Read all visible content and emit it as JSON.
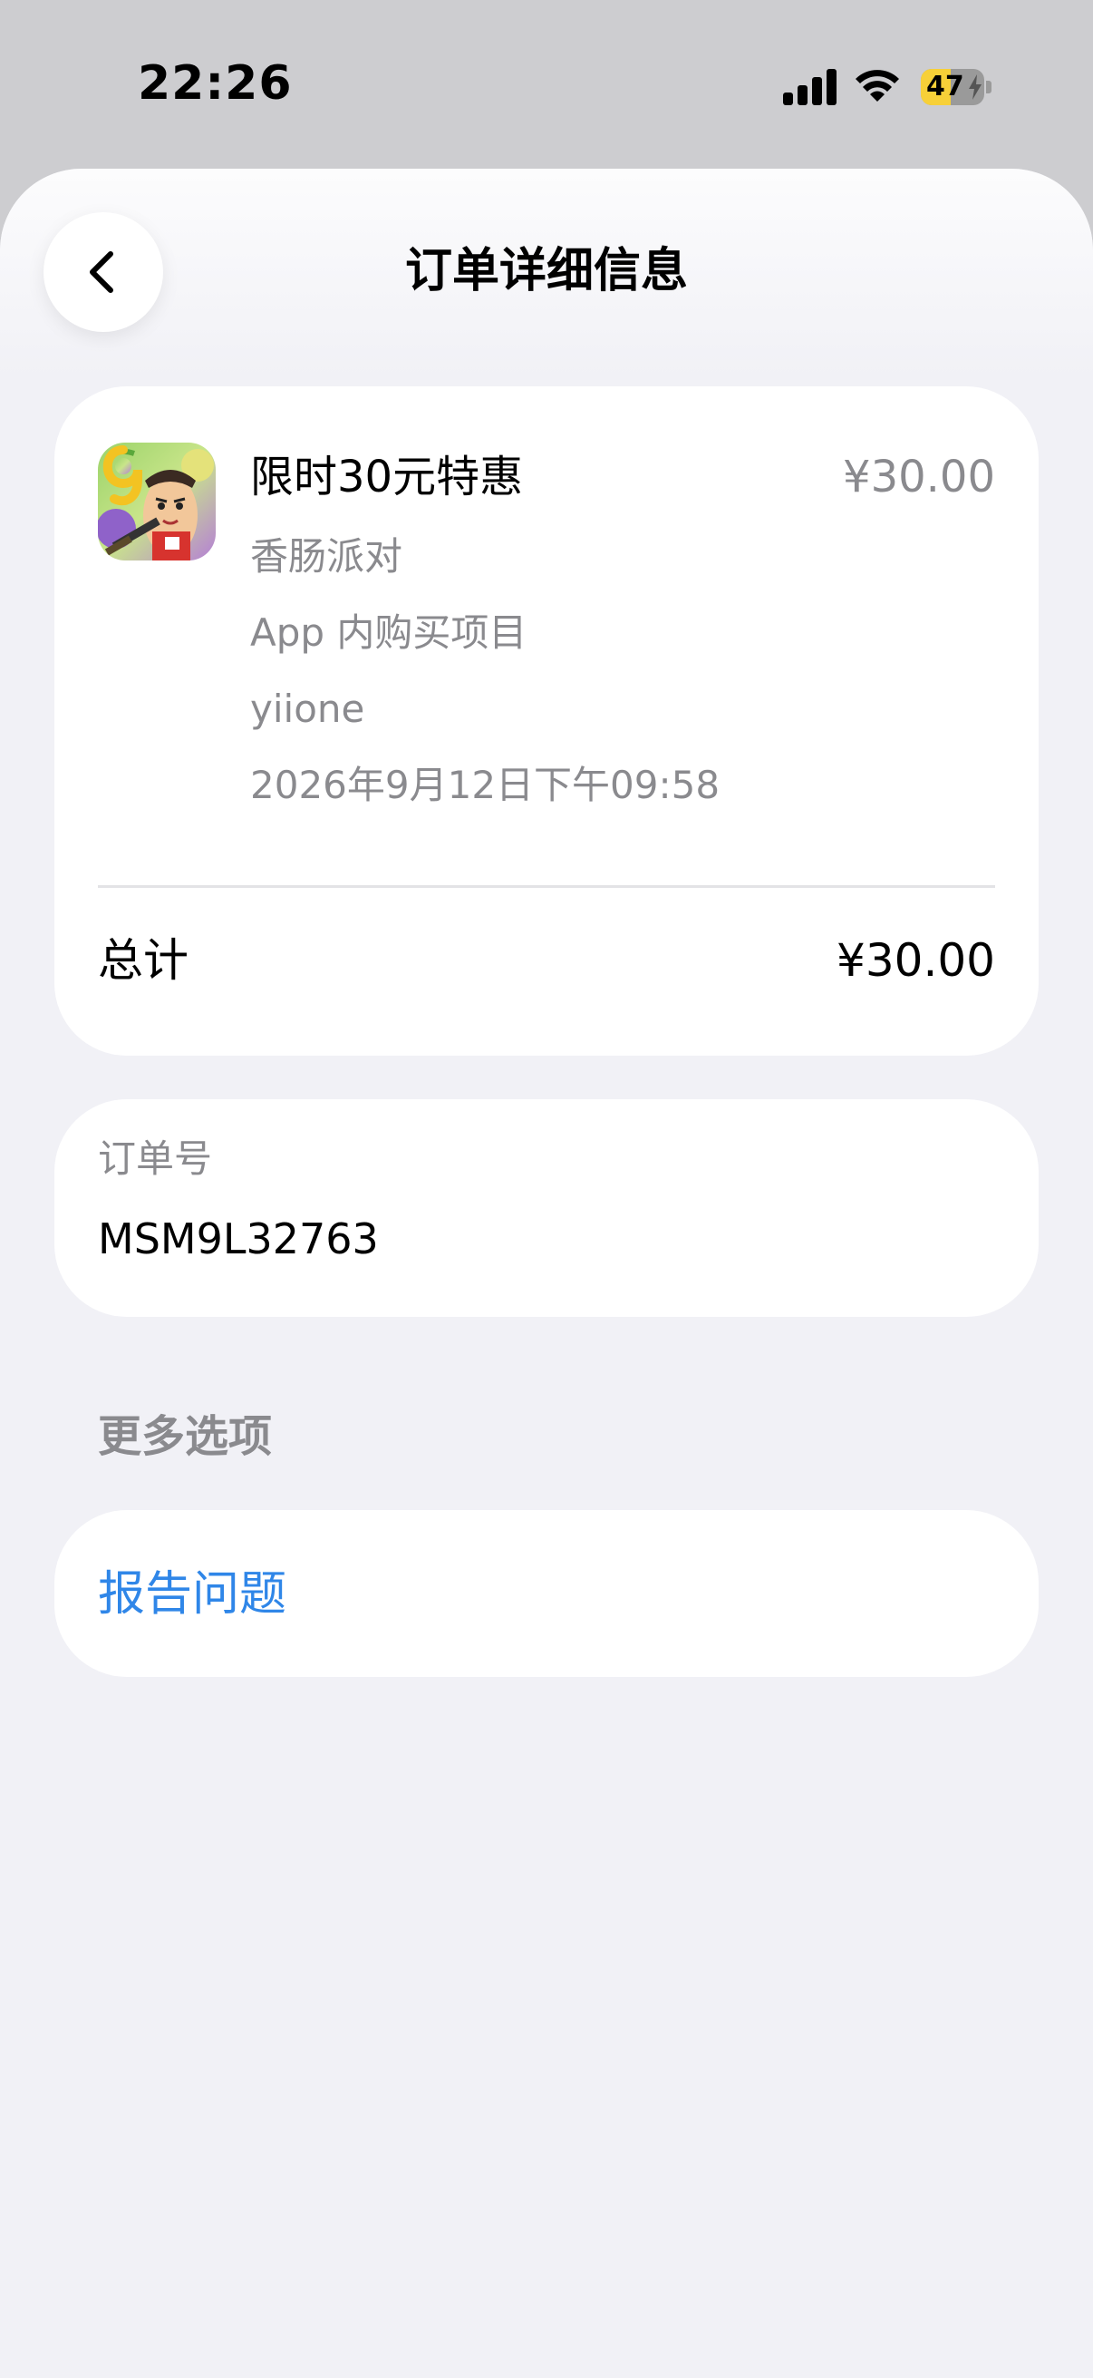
{
  "status_bar": {
    "time": "22:26",
    "battery_level": "47",
    "battery_fraction": 0.47,
    "icons": [
      "signal-icon",
      "wifi-icon",
      "battery-icon"
    ]
  },
  "header": {
    "title": "订单详细信息",
    "back_icon": "chevron-left-icon"
  },
  "order": {
    "item_title": "限时30元特惠",
    "item_price": "¥30.00",
    "app_name": "香肠派对",
    "purchase_type": "App 内购买项目",
    "account": "yiione",
    "date": "2026年9月12日下午09:58",
    "total_label": "总计",
    "total_value": "¥30.00"
  },
  "order_number": {
    "label": "订单号",
    "value": "MSM9L32763"
  },
  "more_options": {
    "header": "更多选项",
    "report_label": "报告问题"
  },
  "colors": {
    "link": "#2f86e8",
    "secondary_text": "#8a8a8e",
    "background": "#f1f1f6",
    "card": "#ffffff",
    "battery": "#f7d038"
  }
}
